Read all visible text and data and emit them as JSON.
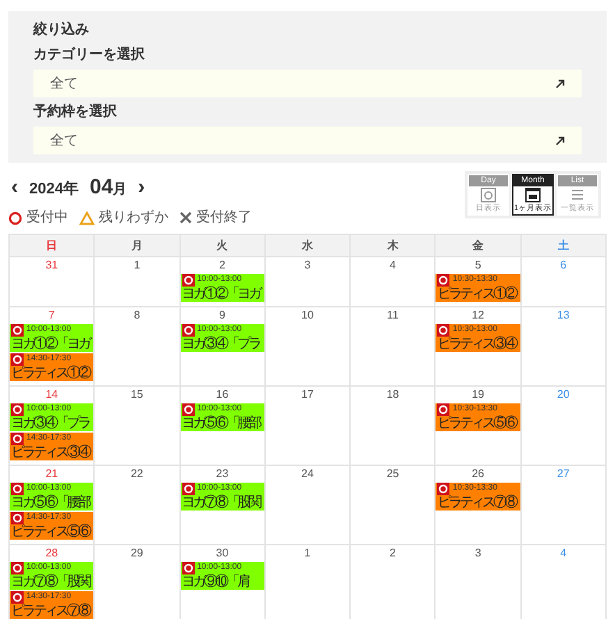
{
  "filter": {
    "title": "絞り込み",
    "fields": [
      {
        "label": "カテゴリーを選択",
        "value": "全て"
      },
      {
        "label": "予約枠を選択",
        "value": "全て"
      }
    ]
  },
  "nav": {
    "prev": "‹",
    "year": "2024年",
    "month": "04",
    "month_unit": "月",
    "next": "›"
  },
  "legend": [
    {
      "kind": "open",
      "label": "受付中"
    },
    {
      "kind": "few",
      "label": "残りわずか"
    },
    {
      "kind": "closed",
      "label": "受付終了"
    }
  ],
  "views": [
    {
      "header": "Day",
      "label": "日表示",
      "kind": "day",
      "selected": false
    },
    {
      "header": "Month",
      "label": "1ヶ月表示",
      "kind": "month",
      "selected": true
    },
    {
      "header": "List",
      "label": "一覧表示",
      "kind": "list",
      "selected": false
    }
  ],
  "weekdays": [
    "日",
    "月",
    "火",
    "水",
    "木",
    "金",
    "土"
  ],
  "weeks": [
    {
      "days": [
        {
          "date": "31"
        },
        {
          "date": "1"
        },
        {
          "date": "2",
          "events": [
            {
              "time": "10:00-13:00",
              "title": "ヨガ①②「ヨガ",
              "color": "#80ff00"
            }
          ]
        },
        {
          "date": "3"
        },
        {
          "date": "4"
        },
        {
          "date": "5",
          "events": [
            {
              "time": "10:30-13:30",
              "title": "ピラティス①②",
              "color": "#ff8000"
            }
          ]
        },
        {
          "date": "6"
        }
      ]
    },
    {
      "days": [
        {
          "date": "7",
          "events": [
            {
              "time": "10:00-13:00",
              "title": "ヨガ①②「ヨガ",
              "color": "#80ff00"
            },
            {
              "time": "14:30-17:30",
              "title": "ピラティス①②",
              "color": "#ff8000"
            }
          ]
        },
        {
          "date": "8"
        },
        {
          "date": "9",
          "events": [
            {
              "time": "10:00-13:00",
              "title": "ヨガ③④「プラ",
              "color": "#80ff00"
            }
          ]
        },
        {
          "date": "10"
        },
        {
          "date": "11"
        },
        {
          "date": "12",
          "events": [
            {
              "time": "10:30-13:00",
              "title": "ピラティス③④",
              "color": "#ff8000"
            }
          ]
        },
        {
          "date": "13"
        }
      ]
    },
    {
      "days": [
        {
          "date": "14",
          "events": [
            {
              "time": "10:00-13:00",
              "title": "ヨガ③④「プラ",
              "color": "#80ff00"
            },
            {
              "time": "14:30-17:30",
              "title": "ピラティス③④",
              "color": "#ff8000"
            }
          ]
        },
        {
          "date": "15"
        },
        {
          "date": "16",
          "events": [
            {
              "time": "10:00-13:00",
              "title": "ヨガ⑤⑥「腰部",
              "color": "#80ff00"
            }
          ]
        },
        {
          "date": "17"
        },
        {
          "date": "18"
        },
        {
          "date": "19",
          "events": [
            {
              "time": "10:30-13:30",
              "title": "ピラティス⑤⑥",
              "color": "#ff8000"
            }
          ]
        },
        {
          "date": "20"
        }
      ]
    },
    {
      "days": [
        {
          "date": "21",
          "events": [
            {
              "time": "10:00-13:00",
              "title": "ヨガ⑤⑥「腰部",
              "color": "#80ff00"
            },
            {
              "time": "14:30-17:30",
              "title": "ピラティス⑤⑥",
              "color": "#ff8000"
            }
          ]
        },
        {
          "date": "22"
        },
        {
          "date": "23",
          "events": [
            {
              "time": "10:00-13:00",
              "title": "ヨガ⑦⑧「股関",
              "color": "#80ff00"
            }
          ]
        },
        {
          "date": "24"
        },
        {
          "date": "25"
        },
        {
          "date": "26",
          "events": [
            {
              "time": "10:30-13:30",
              "title": "ピラティス⑦⑧",
              "color": "#ff8000"
            }
          ]
        },
        {
          "date": "27"
        }
      ]
    },
    {
      "days": [
        {
          "date": "28",
          "events": [
            {
              "time": "10:00-13:00",
              "title": "ヨガ⑦⑧「股関",
              "color": "#80ff00"
            },
            {
              "time": "14:30-17:30",
              "title": "ピラティス⑦⑧",
              "color": "#ff8000"
            }
          ]
        },
        {
          "date": "29"
        },
        {
          "date": "30",
          "events": [
            {
              "time": "10:00-13:00",
              "title": "ヨガ⑨⑩「肩",
              "color": "#80ff00"
            }
          ]
        },
        {
          "date": "1"
        },
        {
          "date": "2"
        },
        {
          "date": "3"
        },
        {
          "date": "4"
        }
      ]
    }
  ]
}
